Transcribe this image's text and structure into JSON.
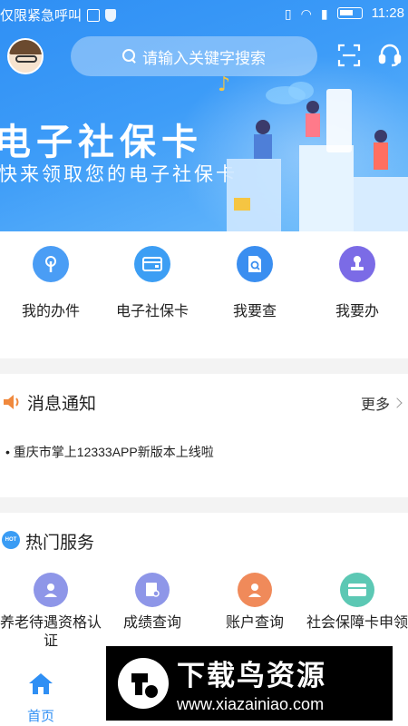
{
  "status_bar": {
    "left_text": "仅限紧急呼叫",
    "time": "11:28"
  },
  "search": {
    "placeholder": "请输入关键字搜索"
  },
  "banner": {
    "title": "电子社保卡",
    "subtitle": "快来领取您的电子社保卡"
  },
  "quick_actions": [
    {
      "label": "我的办件",
      "color": "#4a9df5",
      "icon": "hand-tap-icon"
    },
    {
      "label": "电子社保卡",
      "color": "#3c9ef4",
      "icon": "card-icon"
    },
    {
      "label": "我要查",
      "color": "#3a8ef0",
      "icon": "doc-search-icon"
    },
    {
      "label": "我要办",
      "color": "#7b6be6",
      "icon": "stamp-icon"
    }
  ],
  "notice": {
    "title": "消息通知",
    "more_label": "更多",
    "items": [
      "• 重庆市掌上12333APP新版本上线啦"
    ]
  },
  "hot_services": {
    "title": "热门服务",
    "badge": "HOT",
    "items": [
      {
        "label": "养老待遇资格认证",
        "color": "#8e96e8",
        "icon": "person-certify-icon"
      },
      {
        "label": "成绩查询",
        "color": "#8e96e8",
        "icon": "score-search-icon"
      },
      {
        "label": "账户查询",
        "color": "#f08a5a",
        "icon": "account-icon"
      },
      {
        "label": "社会保障卡申领",
        "color": "#5cc8b4",
        "icon": "card-apply-icon"
      }
    ]
  },
  "tabbar": {
    "home_label": "首页"
  },
  "watermark": {
    "title": "下载鸟资源",
    "url": "www.xiazainiao.com"
  }
}
